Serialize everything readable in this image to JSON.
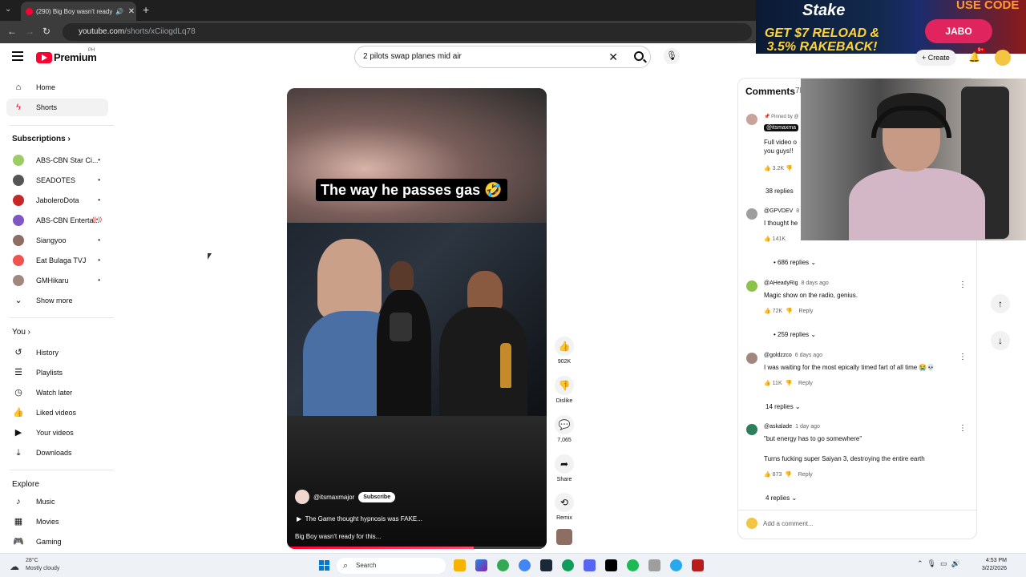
{
  "browser": {
    "tab_title": "(290) Big Boy wasn't ready",
    "url_host": "youtube.com",
    "url_path": "/shorts/xCiiogdLq78"
  },
  "ad": {
    "brand": "Stake",
    "line1": "GET $7 RELOAD &",
    "line2": "3.5% RAKEBACK!",
    "use_code": "USE CODE",
    "code": "JABO"
  },
  "header": {
    "logo_text": "Premium",
    "country": "PH",
    "search_value": "2 pilots swap planes mid air",
    "create_label": "Create",
    "notif_count": "9+"
  },
  "sidebar": {
    "main": [
      {
        "label": "Home",
        "icon": "home-icon"
      },
      {
        "label": "Shorts",
        "icon": "shorts-icon"
      }
    ],
    "subscriptions_heading": "Subscriptions",
    "subscriptions": [
      {
        "label": "ABS-CBN Star Ci...",
        "color": "#9ccc65",
        "badge": "•"
      },
      {
        "label": "SEADOTES",
        "color": "#555555",
        "badge": "•"
      },
      {
        "label": "JaboleroDota",
        "color": "#c62828",
        "badge": "•"
      },
      {
        "label": "ABS-CBN Enterta...",
        "color": "#7e57c2",
        "badge": "((•))"
      },
      {
        "label": "Siangyoo",
        "color": "#8d6e63",
        "badge": "•"
      },
      {
        "label": "Eat Bulaga TVJ",
        "color": "#ef5350",
        "badge": "•"
      },
      {
        "label": "GMHikaru",
        "color": "#a1887f",
        "badge": "•"
      }
    ],
    "show_more": "Show more",
    "you_heading": "You",
    "you_items": [
      {
        "label": "History",
        "icon": "history-icon"
      },
      {
        "label": "Playlists",
        "icon": "playlists-icon"
      },
      {
        "label": "Watch later",
        "icon": "watch-later-icon"
      },
      {
        "label": "Liked videos",
        "icon": "liked-icon"
      },
      {
        "label": "Your videos",
        "icon": "your-videos-icon"
      },
      {
        "label": "Downloads",
        "icon": "download-icon"
      }
    ],
    "explore_heading": "Explore",
    "explore_items": [
      {
        "label": "Music",
        "icon": "music-icon"
      },
      {
        "label": "Movies",
        "icon": "movies-icon"
      },
      {
        "label": "Gaming",
        "icon": "gaming-icon"
      }
    ]
  },
  "short": {
    "caption": "The way he passes gas 🤣",
    "channel": "@itsmaxmajor",
    "subscribe": "Subscribe",
    "playlist": "The Game thought hypnosis was FAKE...",
    "description": "Big Boy wasn't ready for this...",
    "progress": 0.72
  },
  "actions": {
    "likes": "902K",
    "dislike": "Dislike",
    "comments": "7,065",
    "share": "Share",
    "remix": "Remix"
  },
  "comments_panel": {
    "title": "Comments",
    "count": "7K",
    "pinned_label": "Pinned by @",
    "items": [
      {
        "author": "@itsmaxma",
        "age": "",
        "text": "Full video o\nyou guys!!",
        "likes": "3.2K",
        "reply": "",
        "replies": "38 replies",
        "color": "#c9a29a"
      },
      {
        "author": "@GPVDEV",
        "age": "8",
        "text": "I thought he",
        "likes": "141K",
        "reply": "",
        "replies": "686 replies",
        "color": "#9e9e9e"
      },
      {
        "author": "@AHeadyRig",
        "age": "8 days ago",
        "text": "Magic show on the radio, genius.",
        "likes": "72K",
        "reply": "Reply",
        "replies": "259 replies",
        "color": "#8bc34a"
      },
      {
        "author": "@goldzzco",
        "age": "6 days ago",
        "text": "I was waiting for the most epically timed fart of all time 😭💀",
        "likes": "11K",
        "reply": "Reply",
        "replies": "14 replies",
        "color": "#a1887f"
      },
      {
        "author": "@askalade",
        "age": "1 day ago",
        "text": "\"but energy has to go somewhere\"",
        "text2": "Turns fucking super Saiyan 3, destroying the entire earth",
        "likes": "873",
        "reply": "Reply",
        "replies": "4 replies",
        "color": "#2e7d5b"
      }
    ],
    "add_comment": "Add a comment..."
  },
  "taskbar": {
    "temp": "28°C",
    "weather": "Mostly cloudy",
    "search": "Search",
    "time": "4:53 PM",
    "date": "3/22/2026"
  }
}
